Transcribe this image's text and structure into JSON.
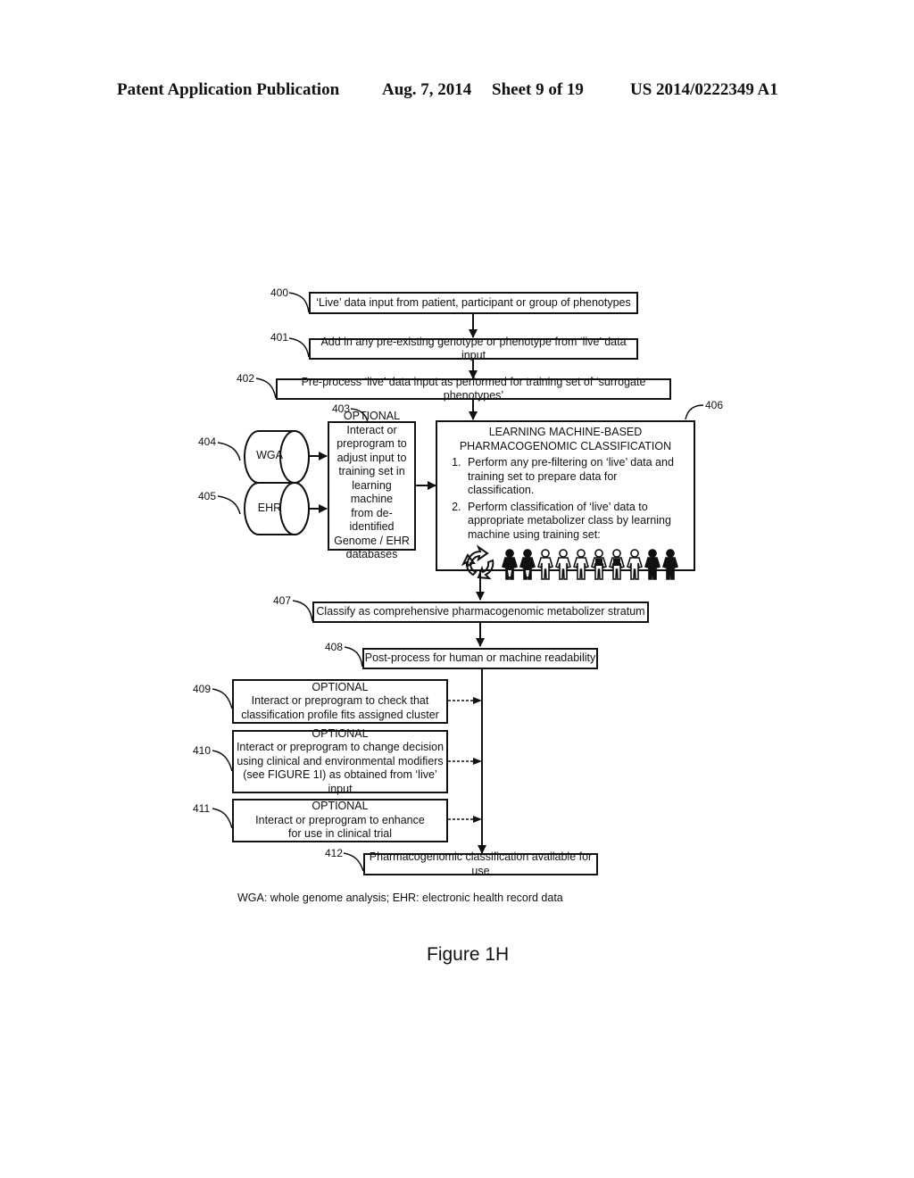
{
  "header": {
    "left": "Patent Application Publication",
    "date": "Aug. 7, 2014",
    "sheet": "Sheet 9 of 19",
    "number": "US 2014/0222349 A1"
  },
  "steps": {
    "s400": {
      "ref": "400",
      "text": "‘Live’ data input from patient, participant or group of phenotypes"
    },
    "s401": {
      "ref": "401",
      "text": "Add in any pre-existing genotype or phenotype from ‘live’ data input"
    },
    "s402": {
      "ref": "402",
      "text": "Pre-process ‘live’ data input as performed for training set of ‘surrogate phenotypes’"
    },
    "s403": {
      "ref": "403",
      "title": "OPTIONAL",
      "lines": [
        "Interact or",
        "preprogram to",
        "adjust input to",
        "training set in",
        "learning machine",
        "from de-identified",
        "Genome / EHR",
        "databases"
      ]
    },
    "s404": {
      "ref": "404",
      "label": "WGA"
    },
    "s405": {
      "ref": "405",
      "label": "EHR"
    },
    "s406": {
      "ref": "406",
      "title1": "LEARNING MACHINE-BASED",
      "title2": "PHARMACOGENOMIC CLASSIFICATION",
      "items": [
        "Perform any pre-filtering on ‘live’ data and training set to prepare data for classification.",
        "Perform classification of ‘live’ data to appropriate metabolizer class by learning machine using training set:"
      ],
      "icons": [
        "recycle-icon",
        "person-dark",
        "person-dark",
        "person-outline",
        "person-outline",
        "person-outline",
        "person-dark-top",
        "person-dark-top",
        "person-outline",
        "person-solid",
        "person-solid"
      ]
    },
    "s407": {
      "ref": "407",
      "text": "Classify as comprehensive pharmacogenomic metabolizer stratum"
    },
    "s408": {
      "ref": "408",
      "text": "Post-process for human or machine readability"
    },
    "s409": {
      "ref": "409",
      "title": "OPTIONAL",
      "lines": [
        "Interact or preprogram to check that",
        "classification profile fits assigned cluster"
      ]
    },
    "s410": {
      "ref": "410",
      "title": "OPTIONAL",
      "lines": [
        "Interact or preprogram to change decision",
        "using clinical and environmental modifiers",
        "(see FIGURE 1I) as obtained from ‘live’ input"
      ]
    },
    "s411": {
      "ref": "411",
      "title": "OPTIONAL",
      "lines": [
        "Interact or preprogram to enhance",
        "for use in clinical trial"
      ]
    },
    "s412": {
      "ref": "412",
      "text": "Pharmacogenomic classification available for use"
    }
  },
  "footnote": "WGA: whole genome analysis; EHR: electronic health record data",
  "figure_label": "Figure 1H"
}
